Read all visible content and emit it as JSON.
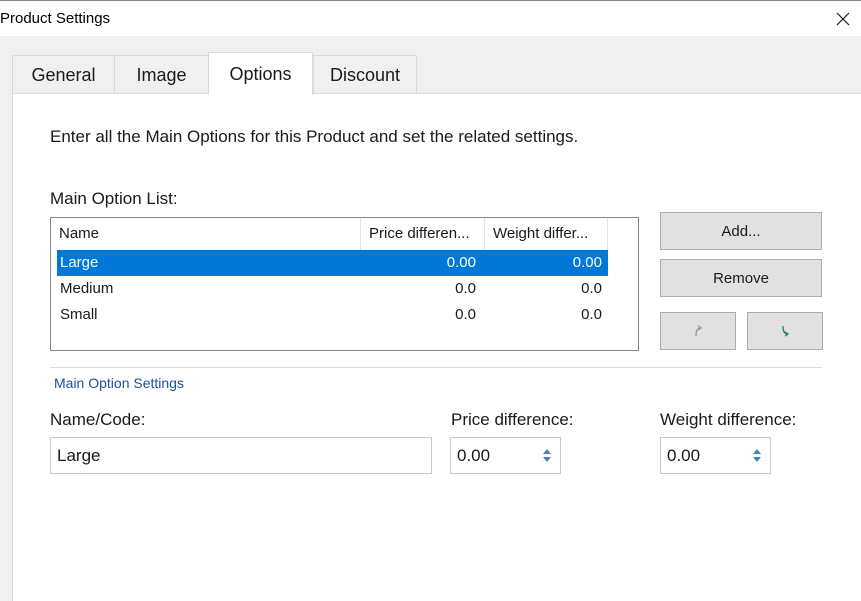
{
  "window": {
    "title": "Product Settings",
    "close_icon": "close-icon"
  },
  "tabs": [
    {
      "label": "General",
      "active": false
    },
    {
      "label": "Image",
      "active": false
    },
    {
      "label": "Options",
      "active": true
    },
    {
      "label": "Discount",
      "active": false
    }
  ],
  "options_tab": {
    "intro": "Enter all the Main Options for this Product and set the related settings.",
    "list_label": "Main Option List:",
    "columns": [
      "Name",
      "Price differen...",
      "Weight differ..."
    ],
    "rows": [
      {
        "name": "Large",
        "price": "0.00",
        "weight": "0.00",
        "selected": true
      },
      {
        "name": "Medium",
        "price": "0.0",
        "weight": "0.0",
        "selected": false
      },
      {
        "name": "Small",
        "price": "0.0",
        "weight": "0.0",
        "selected": false
      }
    ],
    "buttons": {
      "add": "Add...",
      "remove": "Remove",
      "move_up_icon": "move-up-icon",
      "move_down_icon": "move-down-icon"
    },
    "settings_group": "Main Option Settings",
    "name_label": "Name/Code:",
    "name_value": "Large",
    "price_label": "Price difference:",
    "price_value": "0.00",
    "weight_label": "Weight difference:",
    "weight_value": "0.00"
  },
  "colors": {
    "selection": "#0078d7",
    "group_label": "#1f4e9c",
    "move_arrow": "#2e8b57"
  }
}
